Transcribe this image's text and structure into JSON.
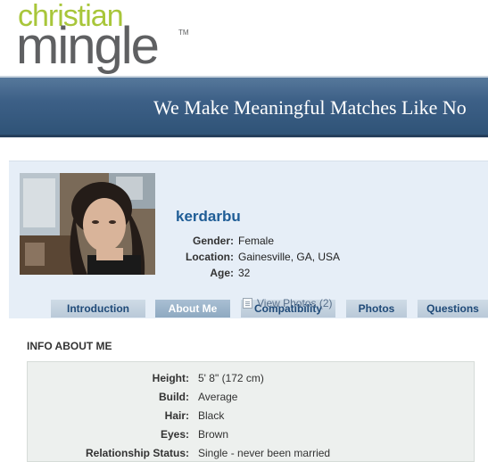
{
  "brand": {
    "logo_top": "christian",
    "logo_bottom": "mingle",
    "trademark": "TM",
    "colors": {
      "green": "#a8c63a",
      "gray": "#5f6062"
    }
  },
  "banner": {
    "tagline": "We Make Meaningful Matches Like No"
  },
  "profile": {
    "username": "kerdarbu",
    "facts": [
      {
        "label": "Gender:",
        "value": "Female"
      },
      {
        "label": "Location:",
        "value": "Gainesville, GA, USA"
      },
      {
        "label": "Age:",
        "value": "32"
      }
    ],
    "view_photos": "View Photos (2)"
  },
  "tabs": [
    {
      "label": "Introduction",
      "active": false
    },
    {
      "label": "About Me",
      "active": true
    },
    {
      "label": "Compatibility",
      "active": false
    },
    {
      "label": "Photos",
      "active": false
    },
    {
      "label": "Questions",
      "active": false
    }
  ],
  "info": {
    "title": "INFO ABOUT ME",
    "rows": [
      {
        "label": "Height:",
        "value": "5' 8\" (172 cm)"
      },
      {
        "label": "Build:",
        "value": "Average"
      },
      {
        "label": "Hair:",
        "value": "Black"
      },
      {
        "label": "Eyes:",
        "value": "Brown"
      },
      {
        "label": "Relationship Status:",
        "value": "Single - never been married"
      }
    ]
  }
}
